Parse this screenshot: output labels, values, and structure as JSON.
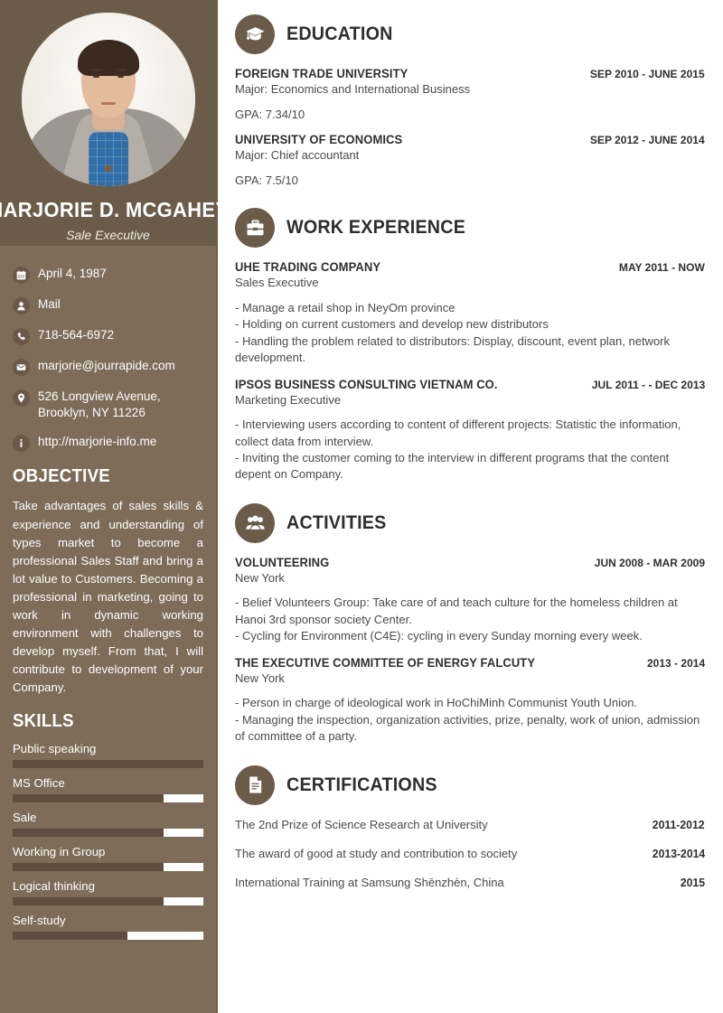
{
  "theme": {
    "sidebar_bg": "#7d6c58",
    "sidebar_header_bg": "#6b5c4a",
    "accent": "#6b5b49",
    "skill_fill": "#5d4e3e",
    "text_dark": "#2f2f2f"
  },
  "profile": {
    "name": "MARJORIE D. MCGAHEY",
    "role": "Sale Executive"
  },
  "contact": [
    {
      "icon": "calendar-icon",
      "text": "April 4, 1987"
    },
    {
      "icon": "person-icon",
      "text": "Mail"
    },
    {
      "icon": "phone-icon",
      "text": "718-564-6972"
    },
    {
      "icon": "envelope-icon",
      "text": "marjorie@jourrapide.com"
    },
    {
      "icon": "map-pin-icon",
      "text": "526 Longview Avenue, Brooklyn, NY 11226"
    },
    {
      "icon": "info-icon",
      "text": "http://marjorie-info.me"
    }
  ],
  "objective": {
    "title": "OBJECTIVE",
    "text": "Take advantages of sales skills & experience and understanding of types market to become a professional Sales Staff and bring a lot value to Customers. Becoming a professional in marketing, going to work in dynamic working environment with challenges to develop myself. From that, I will contribute to development of your Company."
  },
  "skills": {
    "title": "SKILLS",
    "items": [
      {
        "name": "Public speaking",
        "level": 100
      },
      {
        "name": "MS Office",
        "level": 79
      },
      {
        "name": "Sale",
        "level": 79
      },
      {
        "name": "Working in Group",
        "level": 79
      },
      {
        "name": "Logical thinking",
        "level": 79
      },
      {
        "name": "Self-study",
        "level": 60
      }
    ]
  },
  "education": {
    "title": "EDUCATION",
    "icon": "graduation-cap-icon",
    "entries": [
      {
        "school": "FOREIGN TRADE UNIVERSITY",
        "date": "SEP 2010 - JUNE 2015",
        "major": "Major: Economics and International Business",
        "gpa": "GPA: 7.34/10"
      },
      {
        "school": "UNIVERSITY OF ECONOMICS",
        "date": "SEP 2012 - JUNE 2014",
        "major": "Major: Chief accountant",
        "gpa": "GPA: 7.5/10"
      }
    ]
  },
  "work": {
    "title": "WORK EXPERIENCE",
    "icon": "briefcase-icon",
    "entries": [
      {
        "company": "UHE TRADING COMPANY",
        "date": "MAY 2011 - NOW",
        "position": "Sales Executive",
        "bullets": "- Manage a retail shop in NeyOm province\n- Holding on current customers and develop new distributors\n- Handling the problem related to distributors: Display, discount, event plan, network development."
      },
      {
        "company": "IPSOS BUSINESS CONSULTING VIETNAM CO.",
        "date": "JUL 2011 - - DEC 2013",
        "position": "Marketing Executive",
        "bullets": "- Interviewing users according to content of different projects: Statistic the information, collect data from interview.\n- Inviting the customer coming to the interview in different programs that the content depent on Company."
      }
    ]
  },
  "activities": {
    "title": "ACTIVITIES",
    "icon": "people-icon",
    "entries": [
      {
        "org": "VOLUNTEERING",
        "date": "JUN 2008 - MAR 2009",
        "location": "New York",
        "bullets": "- Belief Volunteers Group: Take care of and teach culture for the homeless children at Hanoi 3rd sponsor society Center.\n- Cycling for Environment (C4E): cycling in every Sunday morning every week."
      },
      {
        "org": "THE EXECUTIVE COMMITTEE OF ENERGY FALCUTY",
        "date": "2013 - 2014",
        "location": "New York",
        "bullets": "- Person in charge of ideological work in HoChiMinh Communist Youth Union.\n- Managing the inspection, organization activities, prize, penalty, work of union, admission of committee of a party."
      }
    ]
  },
  "certifications": {
    "title": "CERTIFICATIONS",
    "icon": "document-icon",
    "items": [
      {
        "name": "The 2nd Prize of Science Research at University",
        "date": "2011-2012"
      },
      {
        "name": "The award of good at study and contribution to society",
        "date": "2013-2014"
      },
      {
        "name": "International Training at Samsung Shēnzhèn, China",
        "date": "2015"
      }
    ]
  }
}
